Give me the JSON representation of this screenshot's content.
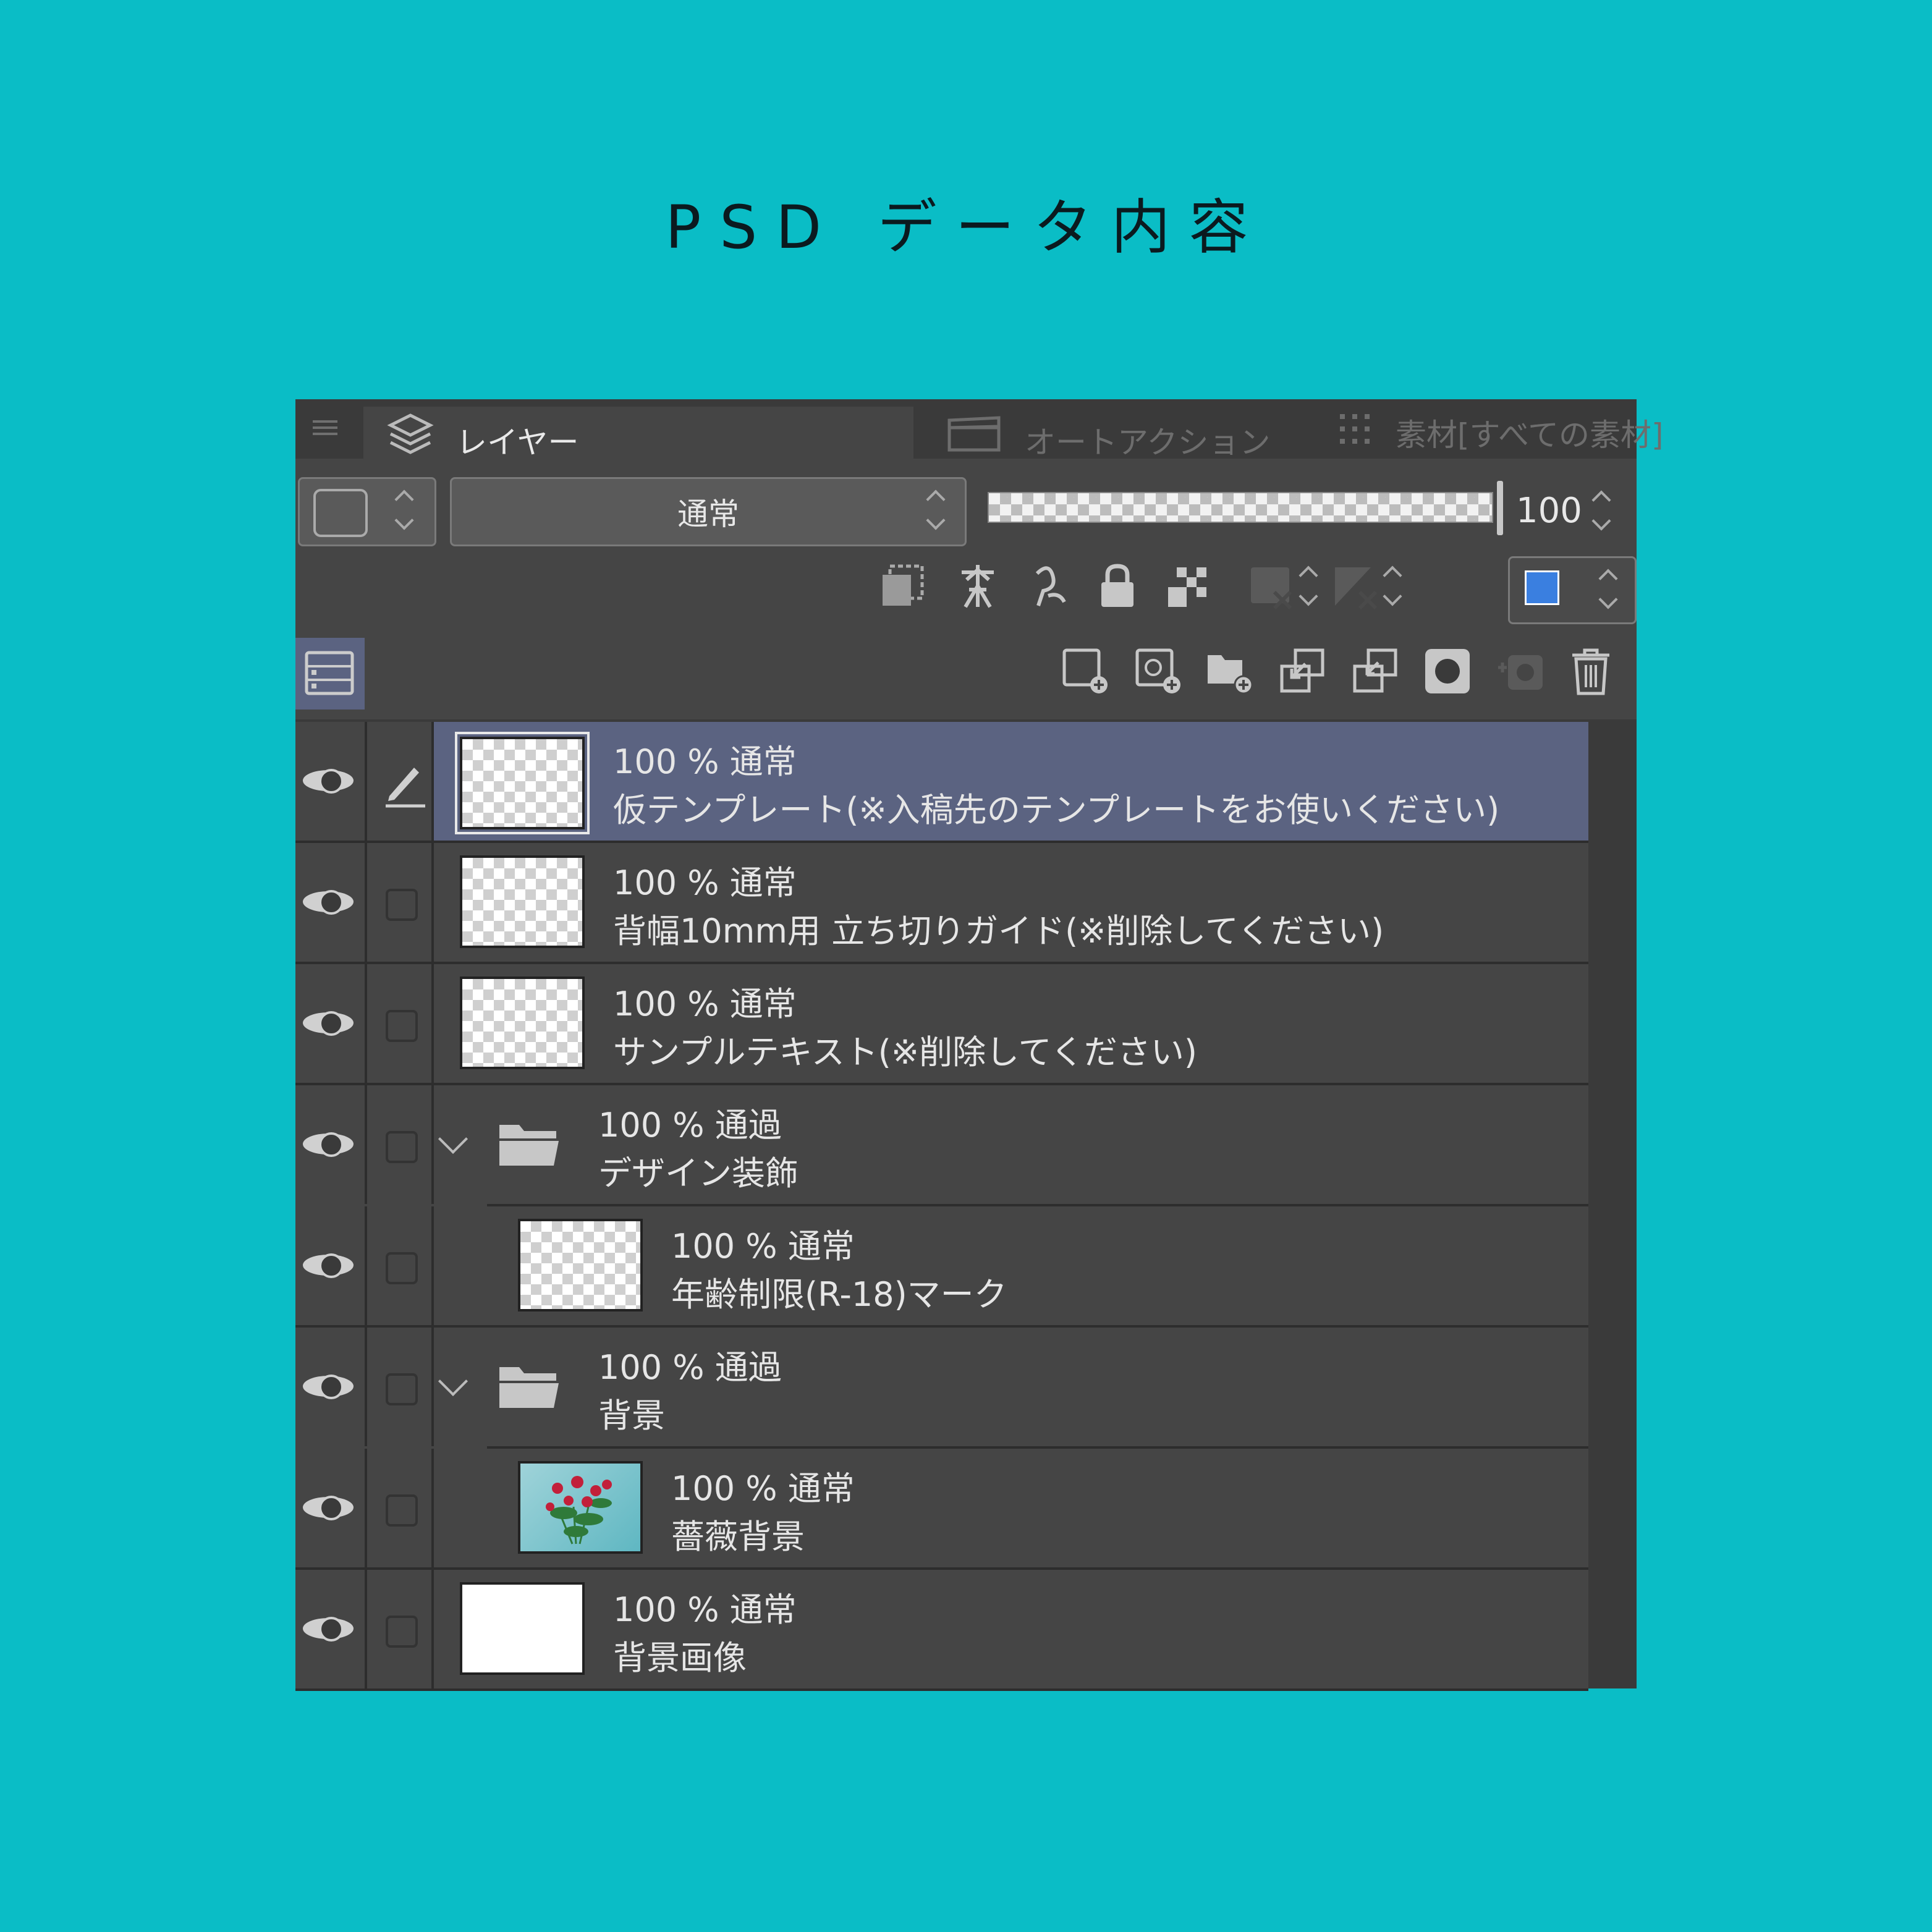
{
  "page_title": "PSD データ内容",
  "tabs": {
    "layer": "レイヤー",
    "auto_action": "オートアクション",
    "material": "素材[すべての素材]"
  },
  "toolbar": {
    "blend_mode": "通常",
    "opacity_value": "100",
    "opacity_fraction": 1.0,
    "main_color": "#3a7fe0"
  },
  "layers": [
    {
      "props": "100 % 通常",
      "name": "仮テンプレート(※入稿先のテンプレートをお使いください)",
      "type": "raster",
      "selected": true,
      "visible": true,
      "thumb": "transparent"
    },
    {
      "props": "100 % 通常",
      "name": "背幅10mm用 立ち切りガイド(※削除してください)",
      "type": "raster",
      "selected": false,
      "visible": true,
      "thumb": "transparent"
    },
    {
      "props": "100 % 通常",
      "name": "サンプルテキスト(※削除してください)",
      "type": "raster",
      "selected": false,
      "visible": true,
      "thumb": "transparent"
    },
    {
      "props": "100 % 通過",
      "name": "デザイン装飾",
      "type": "folder",
      "selected": false,
      "visible": true,
      "expanded": true
    },
    {
      "props": "100 % 通常",
      "name": "年齢制限(R-18)マーク",
      "type": "raster",
      "selected": false,
      "visible": true,
      "indent": 1,
      "thumb": "transparent"
    },
    {
      "props": "100 % 通過",
      "name": "背景",
      "type": "folder",
      "selected": false,
      "visible": true,
      "expanded": true
    },
    {
      "props": "100 % 通常",
      "name": "薔薇背景",
      "type": "raster",
      "selected": false,
      "visible": true,
      "indent": 1,
      "thumb": "photo"
    },
    {
      "props": "100 % 通常",
      "name": "背景画像",
      "type": "raster",
      "selected": false,
      "visible": true,
      "thumb": "white"
    }
  ]
}
